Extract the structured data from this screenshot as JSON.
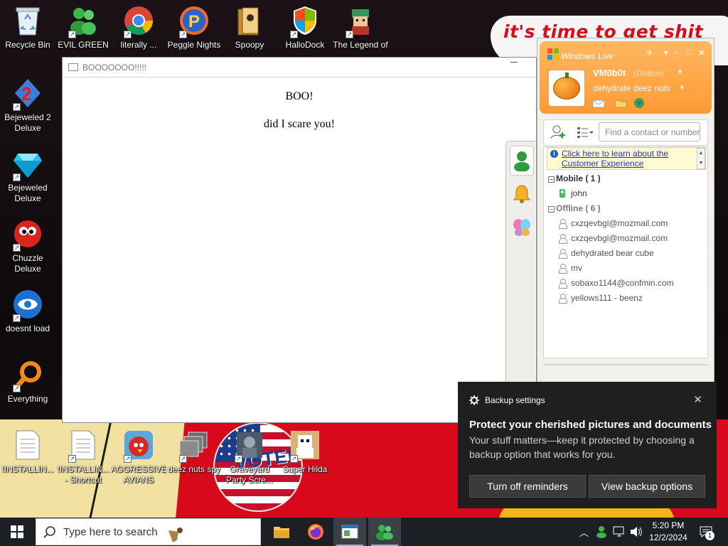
{
  "wallpaper": {
    "banner_text": "it's time to get shit",
    "sticker_text": "VOTED"
  },
  "desktop_icons": [
    {
      "name": "recycle-bin",
      "label": "Recycle Bin"
    },
    {
      "name": "evil-green-men",
      "label": "EVIL GREEN MEN CO..."
    },
    {
      "name": "literally",
      "label": "literally ..."
    },
    {
      "name": "peggle-nights",
      "label": "Peggle Nights Del..."
    },
    {
      "name": "spoopy",
      "label": "Spoopy"
    },
    {
      "name": "hallodock",
      "label": "HalloDock"
    },
    {
      "name": "the-legend",
      "label": "The Legend of Tilda"
    },
    {
      "name": "bejeweled-2",
      "label": "Bejeweled 2 Deluxe"
    },
    {
      "name": "bejeweled",
      "label": "Bejeweled Deluxe"
    },
    {
      "name": "chuzzle",
      "label": "Chuzzle Deluxe"
    },
    {
      "name": "doesnt-load",
      "label": "doesnt load"
    },
    {
      "name": "everything",
      "label": "Everything"
    },
    {
      "name": "installing-1",
      "label": "!INSTALLIN..."
    },
    {
      "name": "installing-2",
      "label": "!INSTALLIN... - Shortcut"
    },
    {
      "name": "aggressive-avians",
      "label": "AGGRESSIVE AVIANS"
    },
    {
      "name": "deez-nuts-spy",
      "label": "deez nuts spy"
    },
    {
      "name": "graveyard",
      "label": "Graveyard Party Scre..."
    },
    {
      "name": "super-hilda",
      "label": "Super Hilda"
    }
  ],
  "boo_window": {
    "title": "BOOOOOOO!!!!!",
    "heading": "BOO!",
    "line": "did I scare you!"
  },
  "messenger": {
    "brand": "Windows Live",
    "display_name": "VM0b0t",
    "status": "(Online)",
    "personal_message": "dehydrate deez nuts",
    "search_placeholder": "Find a contact or number",
    "banner_link": "Click here to learn about the Customer Experience",
    "groups": [
      {
        "label": "Mobile ( 1 )",
        "contacts": [
          "john"
        ]
      },
      {
        "label": "Offline ( 6 )",
        "contacts": [
          "cxzqevbgl@mozmail.com",
          "cxzqevbgl@mozmail.com",
          "dehydrated bear cube",
          "mv",
          "sobaxo1144@confmin.com",
          "yellows111 - beenz"
        ]
      }
    ]
  },
  "toast": {
    "app": "Backup settings",
    "title": "Protect your cherished pictures and documents",
    "body": "Your stuff matters—keep it protected by choosing a backup option that works for you.",
    "button_off": "Turn off reminders",
    "button_view": "View backup options"
  },
  "taskbar": {
    "search_placeholder": "Type here to search",
    "time": "5:20 PM",
    "date": "12/2/2024",
    "notification_count": "1"
  },
  "colors": {
    "messenger_header": "#ff9a35",
    "toast_bg": "#1f1f1f",
    "taskbar_bg": "#1c2024"
  }
}
